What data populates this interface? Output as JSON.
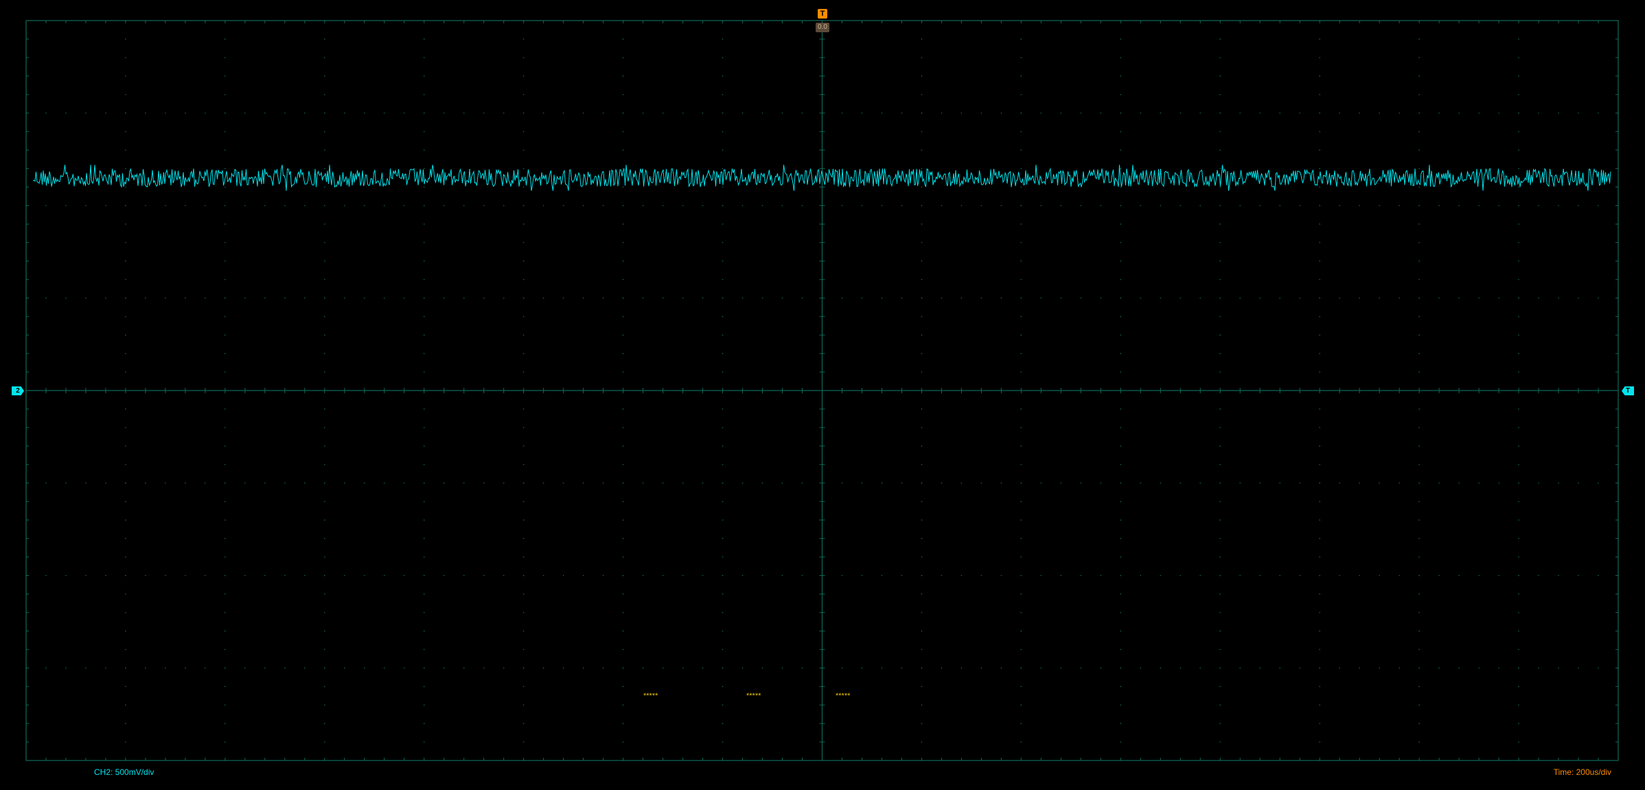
{
  "scope": {
    "trigger_marker": "T",
    "trigger_offset": "0.0",
    "channel_marker": "2",
    "channel_marker_right": "T",
    "channel_scale": "CH2: 500mV/div",
    "time_scale": "Time: 200us/div",
    "placeholder_marks": [
      "*****",
      "*****",
      "*****"
    ],
    "grid": {
      "h_divisions": 16,
      "v_divisions": 8,
      "minor_per_div": 5
    },
    "colors": {
      "background": "#000000",
      "grid": "#0e6a5a",
      "trace": "#00e5ee",
      "trigger": "#ff8c00",
      "placeholder": "#e8c000"
    },
    "trace_data": {
      "channel": "CH2",
      "volts_per_div": 0.5,
      "mean_divisions_above_center": 2.3,
      "noise_peak_to_peak_divisions": 0.2
    }
  }
}
